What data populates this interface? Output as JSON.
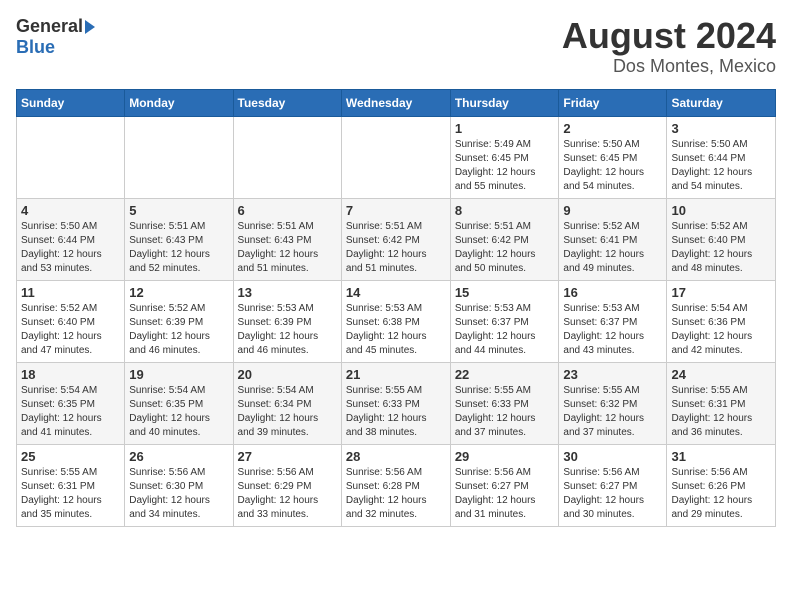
{
  "logo": {
    "general": "General",
    "blue": "Blue"
  },
  "title": "August 2024",
  "subtitle": "Dos Montes, Mexico",
  "days_of_week": [
    "Sunday",
    "Monday",
    "Tuesday",
    "Wednesday",
    "Thursday",
    "Friday",
    "Saturday"
  ],
  "weeks": [
    [
      {
        "day": "",
        "info": ""
      },
      {
        "day": "",
        "info": ""
      },
      {
        "day": "",
        "info": ""
      },
      {
        "day": "",
        "info": ""
      },
      {
        "day": "1",
        "info": "Sunrise: 5:49 AM\nSunset: 6:45 PM\nDaylight: 12 hours\nand 55 minutes."
      },
      {
        "day": "2",
        "info": "Sunrise: 5:50 AM\nSunset: 6:45 PM\nDaylight: 12 hours\nand 54 minutes."
      },
      {
        "day": "3",
        "info": "Sunrise: 5:50 AM\nSunset: 6:44 PM\nDaylight: 12 hours\nand 54 minutes."
      }
    ],
    [
      {
        "day": "4",
        "info": "Sunrise: 5:50 AM\nSunset: 6:44 PM\nDaylight: 12 hours\nand 53 minutes."
      },
      {
        "day": "5",
        "info": "Sunrise: 5:51 AM\nSunset: 6:43 PM\nDaylight: 12 hours\nand 52 minutes."
      },
      {
        "day": "6",
        "info": "Sunrise: 5:51 AM\nSunset: 6:43 PM\nDaylight: 12 hours\nand 51 minutes."
      },
      {
        "day": "7",
        "info": "Sunrise: 5:51 AM\nSunset: 6:42 PM\nDaylight: 12 hours\nand 51 minutes."
      },
      {
        "day": "8",
        "info": "Sunrise: 5:51 AM\nSunset: 6:42 PM\nDaylight: 12 hours\nand 50 minutes."
      },
      {
        "day": "9",
        "info": "Sunrise: 5:52 AM\nSunset: 6:41 PM\nDaylight: 12 hours\nand 49 minutes."
      },
      {
        "day": "10",
        "info": "Sunrise: 5:52 AM\nSunset: 6:40 PM\nDaylight: 12 hours\nand 48 minutes."
      }
    ],
    [
      {
        "day": "11",
        "info": "Sunrise: 5:52 AM\nSunset: 6:40 PM\nDaylight: 12 hours\nand 47 minutes."
      },
      {
        "day": "12",
        "info": "Sunrise: 5:52 AM\nSunset: 6:39 PM\nDaylight: 12 hours\nand 46 minutes."
      },
      {
        "day": "13",
        "info": "Sunrise: 5:53 AM\nSunset: 6:39 PM\nDaylight: 12 hours\nand 46 minutes."
      },
      {
        "day": "14",
        "info": "Sunrise: 5:53 AM\nSunset: 6:38 PM\nDaylight: 12 hours\nand 45 minutes."
      },
      {
        "day": "15",
        "info": "Sunrise: 5:53 AM\nSunset: 6:37 PM\nDaylight: 12 hours\nand 44 minutes."
      },
      {
        "day": "16",
        "info": "Sunrise: 5:53 AM\nSunset: 6:37 PM\nDaylight: 12 hours\nand 43 minutes."
      },
      {
        "day": "17",
        "info": "Sunrise: 5:54 AM\nSunset: 6:36 PM\nDaylight: 12 hours\nand 42 minutes."
      }
    ],
    [
      {
        "day": "18",
        "info": "Sunrise: 5:54 AM\nSunset: 6:35 PM\nDaylight: 12 hours\nand 41 minutes."
      },
      {
        "day": "19",
        "info": "Sunrise: 5:54 AM\nSunset: 6:35 PM\nDaylight: 12 hours\nand 40 minutes."
      },
      {
        "day": "20",
        "info": "Sunrise: 5:54 AM\nSunset: 6:34 PM\nDaylight: 12 hours\nand 39 minutes."
      },
      {
        "day": "21",
        "info": "Sunrise: 5:55 AM\nSunset: 6:33 PM\nDaylight: 12 hours\nand 38 minutes."
      },
      {
        "day": "22",
        "info": "Sunrise: 5:55 AM\nSunset: 6:33 PM\nDaylight: 12 hours\nand 37 minutes."
      },
      {
        "day": "23",
        "info": "Sunrise: 5:55 AM\nSunset: 6:32 PM\nDaylight: 12 hours\nand 37 minutes."
      },
      {
        "day": "24",
        "info": "Sunrise: 5:55 AM\nSunset: 6:31 PM\nDaylight: 12 hours\nand 36 minutes."
      }
    ],
    [
      {
        "day": "25",
        "info": "Sunrise: 5:55 AM\nSunset: 6:31 PM\nDaylight: 12 hours\nand 35 minutes."
      },
      {
        "day": "26",
        "info": "Sunrise: 5:56 AM\nSunset: 6:30 PM\nDaylight: 12 hours\nand 34 minutes."
      },
      {
        "day": "27",
        "info": "Sunrise: 5:56 AM\nSunset: 6:29 PM\nDaylight: 12 hours\nand 33 minutes."
      },
      {
        "day": "28",
        "info": "Sunrise: 5:56 AM\nSunset: 6:28 PM\nDaylight: 12 hours\nand 32 minutes."
      },
      {
        "day": "29",
        "info": "Sunrise: 5:56 AM\nSunset: 6:27 PM\nDaylight: 12 hours\nand 31 minutes."
      },
      {
        "day": "30",
        "info": "Sunrise: 5:56 AM\nSunset: 6:27 PM\nDaylight: 12 hours\nand 30 minutes."
      },
      {
        "day": "31",
        "info": "Sunrise: 5:56 AM\nSunset: 6:26 PM\nDaylight: 12 hours\nand 29 minutes."
      }
    ]
  ]
}
